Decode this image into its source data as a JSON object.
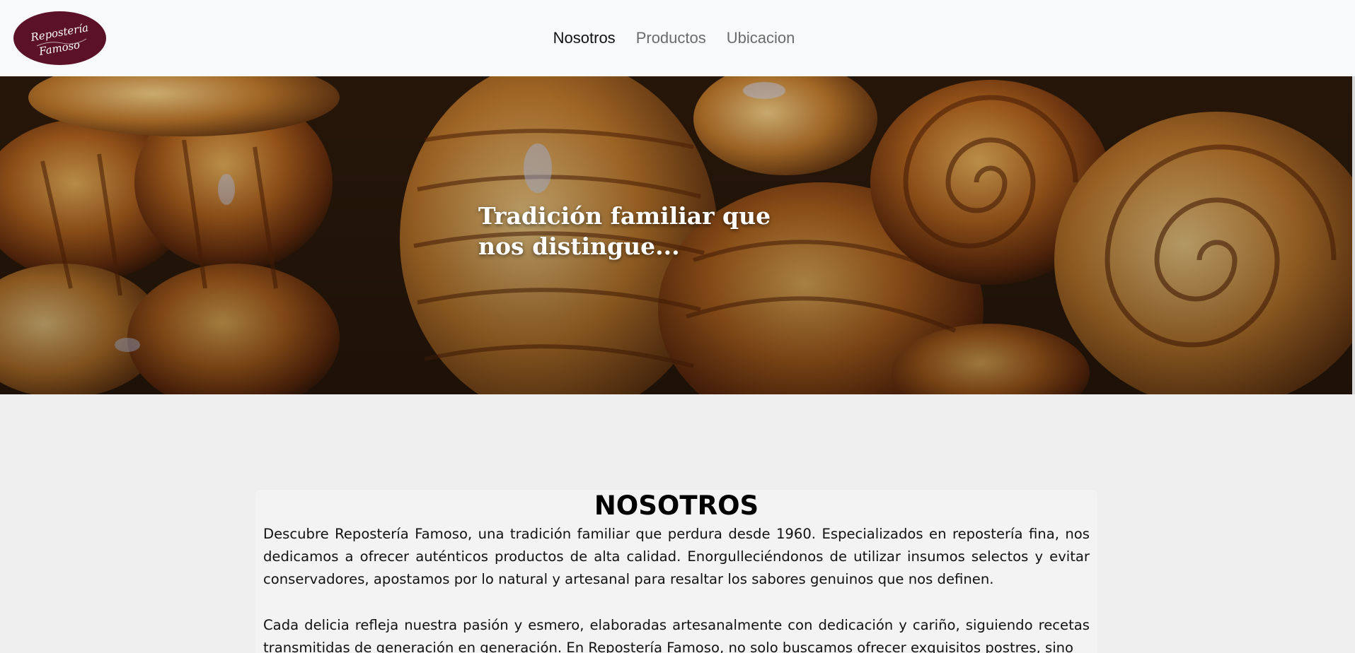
{
  "brand": {
    "logo_line1": "Repostería",
    "logo_line2": "Famoso",
    "logo_color": "#5b1228"
  },
  "nav": {
    "items": [
      {
        "label": "Nosotros",
        "active": true
      },
      {
        "label": "Productos",
        "active": false
      },
      {
        "label": "Ubicacion",
        "active": false
      }
    ]
  },
  "hero": {
    "title_line1": "Tradición familiar que",
    "title_line2": "nos distingue...",
    "image": "pastries-photo"
  },
  "about": {
    "heading": "NOSOTROS",
    "paragraph1": "Descubre Repostería Famoso, una tradición familiar que perdura desde 1960. Especializados en repostería fina, nos dedicamos a ofrecer auténticos productos de alta calidad. Enorgulleciéndonos de utilizar insumos selectos y evitar conservadores, apostamos por lo natural y artesanal para resaltar los sabores genuinos que nos definen.",
    "paragraph2": "Cada delicia refleja nuestra pasión y esmero, elaboradas artesanalmente con dedicación y cariño, siguiendo recetas transmitidas de generación en generación. En Repostería Famoso, no solo buscamos ofrecer exquisitos postres, sino"
  }
}
